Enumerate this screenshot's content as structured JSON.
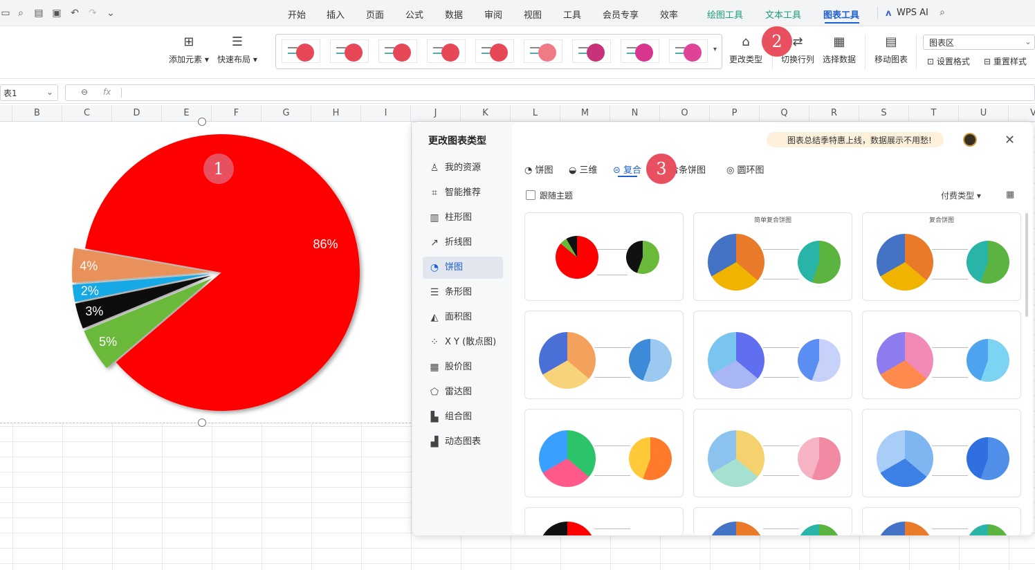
{
  "menubar": {
    "tabs": [
      "开始",
      "插入",
      "页面",
      "公式",
      "数据",
      "审阅",
      "视图",
      "工具",
      "会员专享",
      "效率"
    ],
    "context_tabs": [
      "绘图工具",
      "文本工具",
      "图表工具"
    ],
    "active_tab": "图表工具",
    "wps_ai": "WPS AI"
  },
  "ribbon": {
    "add_element": "添加元素",
    "quick_layout": "快速布局",
    "change_type": "更改类型",
    "switch_row_col": "切换行列",
    "select_data": "选择数据",
    "move_chart": "移动图表",
    "area_select": "图表区",
    "set_format": "设置格式",
    "reset_style": "重置样式"
  },
  "formula_bar": {
    "name_box": "表1",
    "fx": "fx"
  },
  "columns": [
    "B",
    "C",
    "D",
    "E",
    "F",
    "G",
    "H",
    "I",
    "J",
    "K",
    "L",
    "M",
    "N",
    "O",
    "P",
    "Q",
    "R",
    "S",
    "T",
    "U",
    "V"
  ],
  "chart_data": {
    "type": "pie",
    "categories": [
      "",
      "",
      "",
      "",
      ""
    ],
    "values": [
      86,
      5,
      3,
      2,
      4
    ],
    "labels": [
      "86%",
      "5%",
      "3%",
      "2%",
      "4%"
    ],
    "colors": [
      "#ff0000",
      "#6ab93a",
      "#111111",
      "#16a9e6",
      "#e8915a"
    ]
  },
  "badges": {
    "one": "1",
    "two": "2",
    "three": "3"
  },
  "dialog": {
    "title": "更改图表类型",
    "nav": [
      "我的资源",
      "智能推荐",
      "柱形图",
      "折线图",
      "饼图",
      "条形图",
      "面积图",
      "X Y (散点图)",
      "股价图",
      "雷达图",
      "组合图",
      "动态图表"
    ],
    "selected_nav": "饼图",
    "promo": "图表总结季特惠上线，数据展示不用愁!",
    "tabs": [
      "饼图",
      "三维",
      "复合",
      "复合条饼图",
      "圆环图"
    ],
    "tab_visible": [
      "饼图",
      "三维",
      "复合",
      "合条饼图",
      "圆环图"
    ],
    "active_tab": "复合",
    "follow_theme": "跟随主题",
    "paid_type": "付费类型",
    "cards": [
      {
        "caption": ""
      },
      {
        "caption": "简单复合饼图"
      },
      {
        "caption": "复合饼图"
      },
      {
        "caption": ""
      },
      {
        "caption": ""
      },
      {
        "caption": ""
      },
      {
        "caption": ""
      },
      {
        "caption": ""
      },
      {
        "caption": ""
      }
    ]
  }
}
